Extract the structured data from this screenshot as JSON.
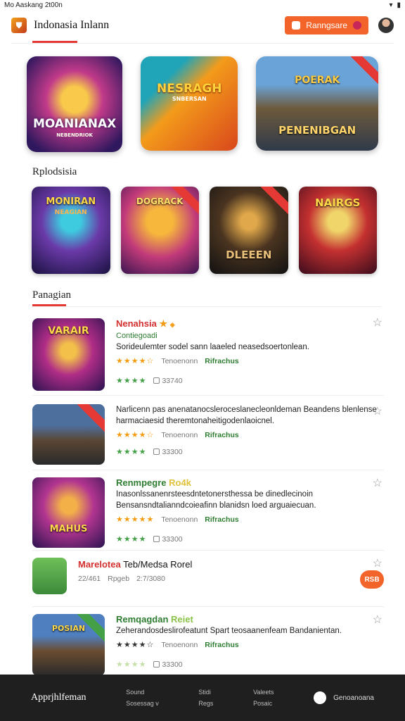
{
  "status_bar": {
    "left_text": "Mo Aaskang 2t00n",
    "icons": [
      "wifi-icon",
      "battery-icon"
    ]
  },
  "header": {
    "title": "Indonasia Inlann",
    "button_label": "Ranngsare",
    "accent": "#f2642a"
  },
  "featured": [
    {
      "title": "MOANIANAX",
      "subtitle": "NEBENDRIOK"
    },
    {
      "title": "NESRAGH",
      "subtitle": "SNBERSAN"
    },
    {
      "title": "PENENIBGAN",
      "subtitle": "POERAK"
    }
  ],
  "section1": {
    "title": "Rplodsisia"
  },
  "grid": [
    {
      "title": "MONIRAN",
      "subtitle": "NEAGIAN"
    },
    {
      "title": "DOGRACK",
      "subtitle": ""
    },
    {
      "title": "DLEEEN",
      "subtitle": ""
    },
    {
      "title": "NAIRGS",
      "subtitle": ""
    }
  ],
  "section2": {
    "title": "Panagian"
  },
  "list": [
    {
      "thumb_title": "VARAIR",
      "title": "Nenahsia",
      "subtitle": "Contiegoadi",
      "description": "Sorideulemter sodel sann laaeled neasedsoertonlean.",
      "rank_label": "Tenoenonn",
      "tag": "Rifrachus",
      "count": "33740"
    },
    {
      "thumb_title": "",
      "title": "",
      "subtitle": "",
      "description": "Narlicenn pas anenatanocsleroceslanecleonldeman Beandens blenlense harmaciaesid theremtonaheitigodenlaoicnel.",
      "rank_label": "Tenoenonn",
      "tag": "Rifrachus",
      "count": "33300"
    },
    {
      "thumb_title": "MAHUS",
      "title": "Renmpegre",
      "title_suffix": "Ro4k",
      "subtitle": "",
      "description": "Inasonlssanenrsteesdntetonersthessa be dinedlecinoin Bensansndtalianndcoieafinn blanidsn loed arguaiecuan.",
      "rank_label": "Tenoenonn",
      "tag": "Rifrachus",
      "count": "33300"
    },
    {
      "title": "Marelotea",
      "title_suffix": "Teb/Medsa Rorel",
      "meta": [
        "22/461",
        "Rpgeb",
        "2:7/3080"
      ],
      "fab_label": "RSB"
    },
    {
      "thumb_title": "POSIAN",
      "title": "Remqagdan",
      "title_suffix": "Reiet",
      "subtitle": "",
      "description": "Zeherandosdeslirofeatunt Spart teosaanenfeam Bandanientan.",
      "rank_label": "Tenoenonn",
      "tag": "Rifrachus",
      "count": "33300"
    }
  ],
  "footer": {
    "brand": "Apprjhlfeman",
    "col1": [
      "Sound",
      "Sosessag v"
    ],
    "col2": [
      "Stidi",
      "Regs"
    ],
    "col3": [
      "Valeets",
      "Posaic"
    ],
    "right_label": "Genoanoana"
  }
}
